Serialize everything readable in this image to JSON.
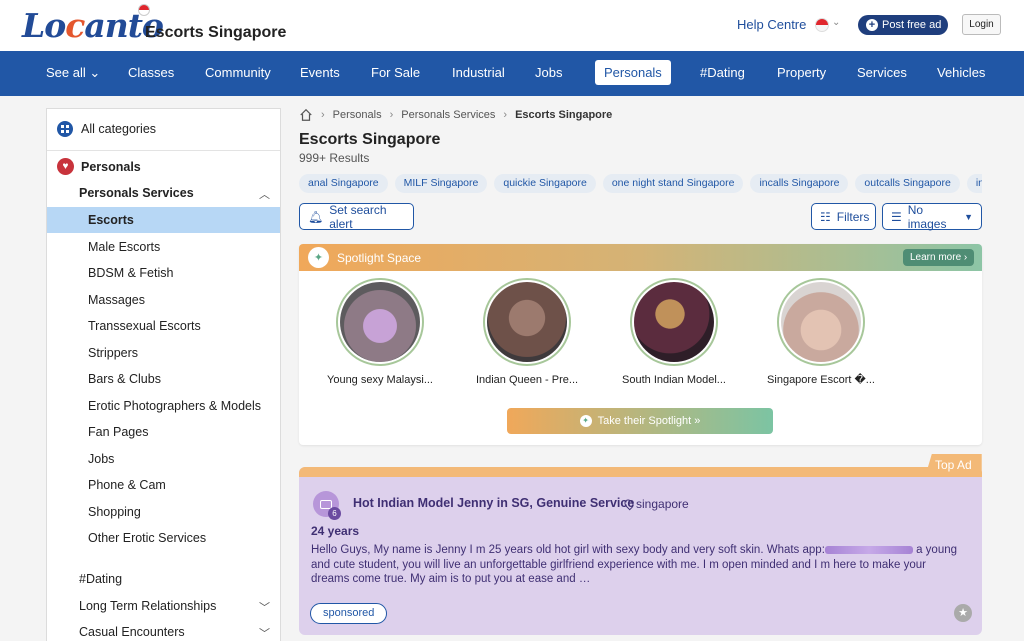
{
  "header": {
    "logo": "Locanto",
    "site_title": "Escorts Singapore",
    "help_label": "Help Centre",
    "post_ad_label": "Post free ad",
    "login_label": "Login"
  },
  "nav": {
    "items": [
      "See all",
      "Classes",
      "Community",
      "Events",
      "For Sale",
      "Industrial",
      "Jobs",
      "Personals",
      "#Dating",
      "Property",
      "Services",
      "Vehicles"
    ],
    "active": "Personals"
  },
  "sidebar": {
    "all_categories": "All categories",
    "personals": "Personals",
    "personals_services": "Personals Services",
    "items": [
      "Escorts",
      "Male Escorts",
      "BDSM & Fetish",
      "Massages",
      "Transsexual Escorts",
      "Strippers",
      "Bars & Clubs",
      "Erotic Photographers & Models",
      "Fan Pages",
      "Jobs",
      "Phone & Cam",
      "Shopping",
      "Other Erotic Services"
    ],
    "active_item": "Escorts",
    "categories": [
      "#Dating",
      "Long Term Relationships",
      "Casual Encounters"
    ]
  },
  "main": {
    "breadcrumb": [
      "Personals",
      "Personals Services",
      "Escorts Singapore"
    ],
    "title": "Escorts Singapore",
    "results": "999+ Results",
    "chips": [
      "anal Singapore",
      "MILF Singapore",
      "quickie Singapore",
      "one night stand Singapore",
      "incalls Singapore",
      "outcalls Singapore",
      "indep"
    ],
    "search_alert_label": "Set search alert",
    "filters_label": "Filters",
    "no_images_label": "No images"
  },
  "spotlight": {
    "title": "Spotlight Space",
    "learn_more": "Learn more",
    "profiles": [
      {
        "name": "Young sexy Malaysi..."
      },
      {
        "name": "Indian Queen - Pre..."
      },
      {
        "name": "South Indian Model..."
      },
      {
        "name": "Singapore Escort �..."
      }
    ],
    "take_label": "Take their Spotlight »"
  },
  "ad": {
    "badge": "Top Ad",
    "photo_count": "6",
    "title": "Hot Indian Model Jenny in SG, Genuine Service",
    "location": "singapore",
    "age": "24 years",
    "desc_before": "Hello Guys, My name is Jenny I m 25 years old hot girl with sexy body and very soft skin. Whats app:",
    "desc_after": " a young and cute student, you will live an unforgettable girlfriend experience with me. I m open minded and I m here to make your dreams come true. My aim is to put you at ease and …",
    "sponsored_label": "sponsored"
  }
}
